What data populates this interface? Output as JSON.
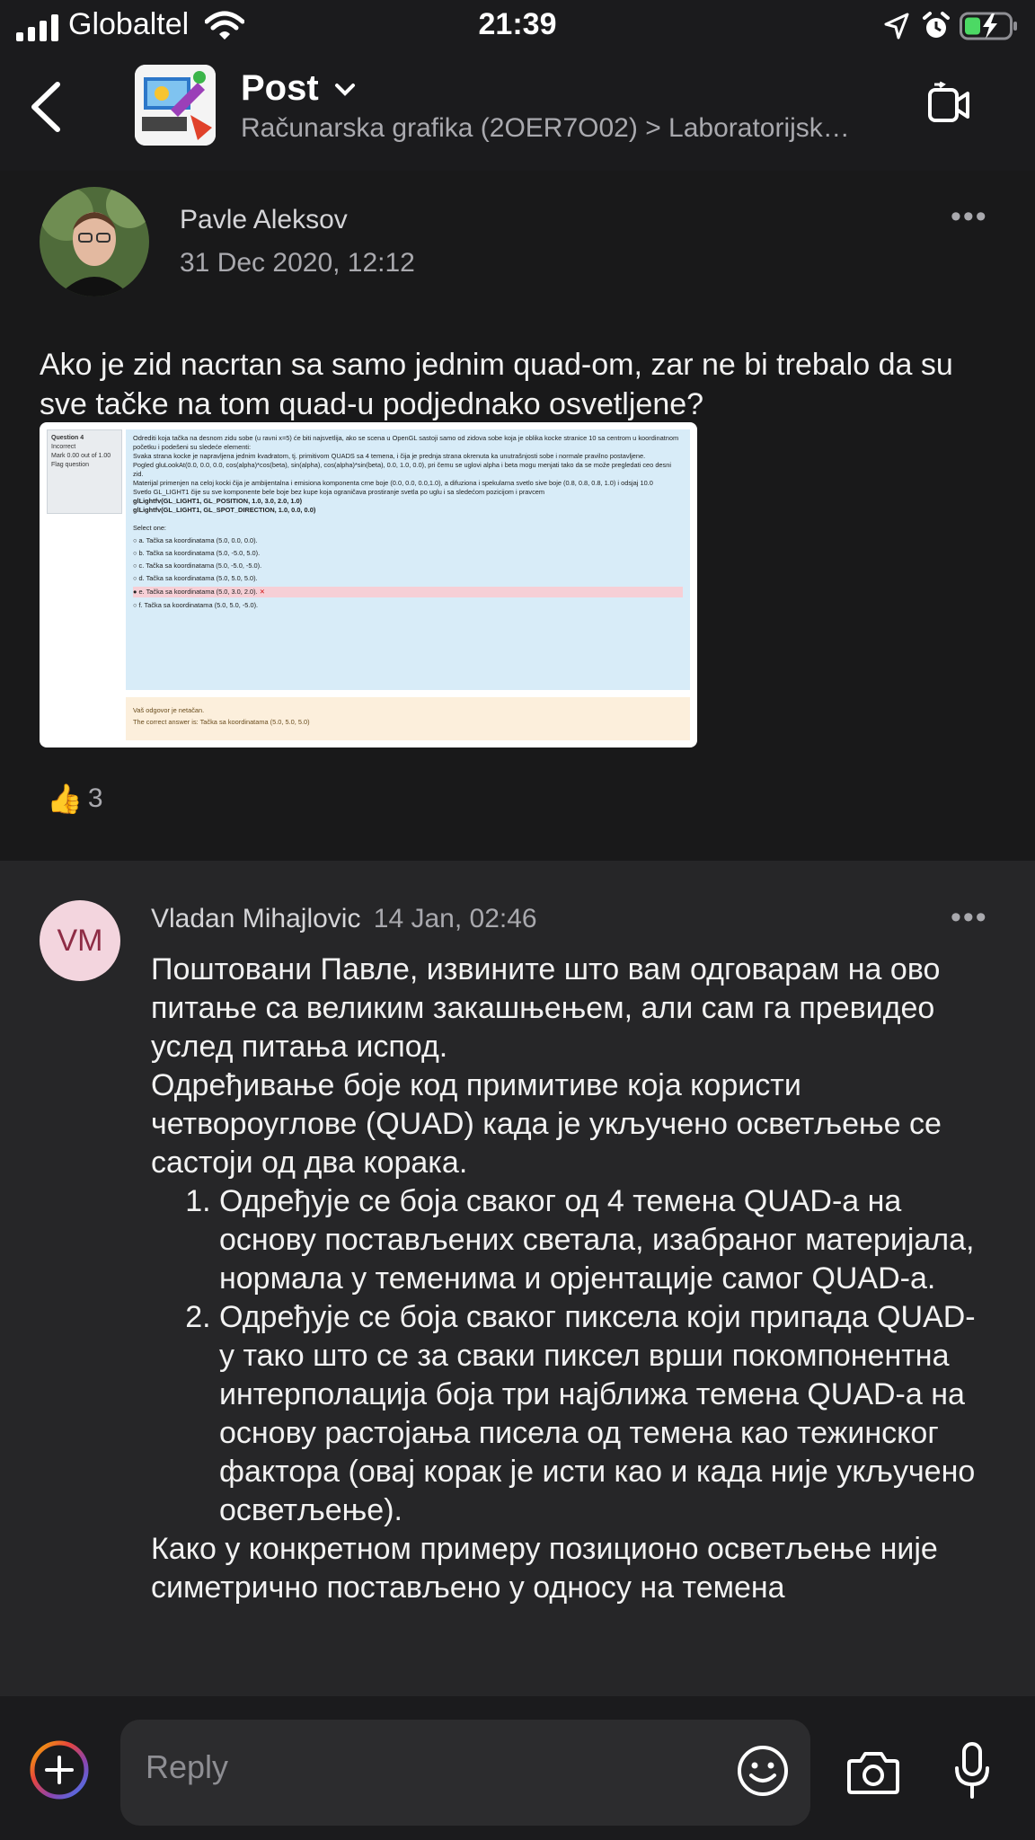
{
  "status_bar": {
    "carrier": "Globaltel",
    "time": "21:39"
  },
  "header": {
    "title": "Post",
    "breadcrumb": "Računarska grafika (2OER7O02) > Laboratorijsk…"
  },
  "post": {
    "author": "Pavle Aleksov",
    "date": "31 Dec 2020, 12:12",
    "text": "Ako je zid nacrtan sa samo jednim quad-om, zar ne bi trebalo da su sve tačke na tom quad-u podjednako osvetljene?",
    "attachment": {
      "side": {
        "question": "Question 4",
        "status": "Incorrect",
        "mark": "Mark 0.00 out of 1.00",
        "flag": "Flag question"
      },
      "lines": [
        "Odrediti koja tačka na desnom zidu sobe (u ravni x=5) će biti najsvetlija, ako se scena u OpenGL sastoji samo od zidova sobe koja je oblika kocke stranice 10 sa centrom u koordinatnom početku i podešeni su sledeće elementi:",
        "Svaka strana kocke je napravljena jednim kvadratom, tj. primitivom QUADS sa 4 temena, i čija je prednja strana okrenuta ka unutrašnjosti sobe i normale pravilno postavljene.",
        "Pogled gluLookAt(0.0, 0.0, 0.0,   cos(alpha)*cos(beta), sin(alpha), cos(alpha)*sin(beta),   0.0, 1.0, 0.0), pri čemu se uglovi alpha i beta mogu menjati tako da se može pregledati ceo desni zid.",
        "Materijal primenjen na celoj kocki čija je ambijentalna i emisiona komponenta crne boje (0.0, 0.0, 0.0,1.0), a difuziona i spekularna svetlo sive boje (0.8, 0.8, 0.8, 1.0) i odsjaj 10.0",
        "Svetlo GL_LIGHT1 čije su sve komponente bele boje bez kupe koja ograničava prostiranje svetla po uglu i sa sledećom pozicijom i pravcem",
        "glLightfv(GL_LIGHT1, GL_POSITION, 1.0, 3.0, 2.0, 1.0)",
        "glLightfv(GL_LIGHT1, GL_SPOT_DIRECTION, 1.0, 0.0, 0.0)"
      ],
      "select_label": "Select one:",
      "options": [
        "a. Tačka sa koordinatama (5.0, 0.0, 0.0).",
        "b. Tačka sa koordinatama (5.0, -5.0, 5.0).",
        "c. Tačka sa koordinatama (5.0, -5.0, -5.0).",
        "d. Tačka sa koordinatama (5.0, 5.0, 5.0).",
        "e. Tačka sa koordinatama (5.0, 3.0, 2.0).",
        "f. Tačka sa koordinatama (5.0, 5.0, -5.0)."
      ],
      "feedback": "Vaš odgovor je netačan.",
      "correct_answer": "The correct answer is: Tačka sa koordinatama (5.0, 5.0, 5.0)"
    },
    "reaction_count": "3"
  },
  "reply": {
    "initials": "VM",
    "author": "Vladan Mihajlovic",
    "date": "14 Jan, 02:46",
    "intro": "Поштовани Павле, извините што вам одговарам на ово питање са великим закашњењем, али сам га превидео услед питања испод.",
    "para2": "Одређивање боје код примитиве која користи четвороуглове (QUAD) када је укључено осветљење се састоји од два корака.",
    "steps": [
      "Одређује се боја сваког од 4 темена QUAD-а на основу постављених светала, изабраног материјала, нормала у теменима и орјентације самог QUAD-а.",
      "Одређује се боја сваког пиксела који припада QUAD-у тако што се за сваки пиксел врши покомпонентна интерполација боја три најближа темена QUAD-а на основу растојања писела од темена као тежинског фактора (овај корак је исти као и када није укључено осветљење)."
    ],
    "para3": "Како у конкретном примеру позиционо осветљење није симетрично постављено у односу на темена"
  },
  "compose": {
    "placeholder": "Reply"
  },
  "colors": {
    "background": "#1b1b1d",
    "reply_background": "#262628",
    "battery_green": "#4cd964",
    "avatar_bg": "#f3d5de",
    "avatar_text": "#8e2c45"
  }
}
